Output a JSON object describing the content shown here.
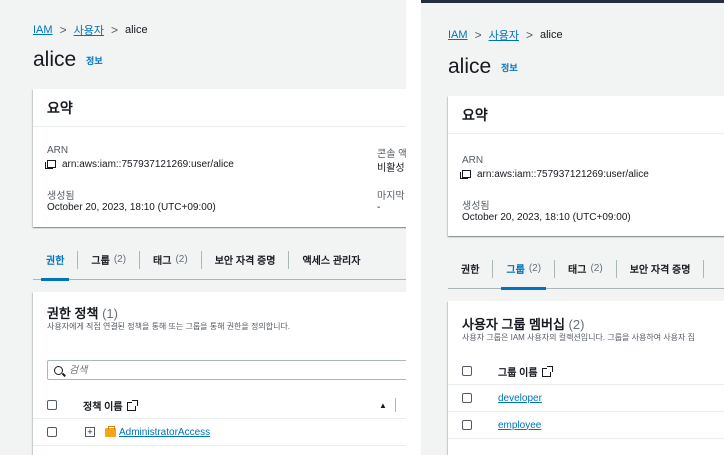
{
  "breadcrumb": {
    "root": "IAM",
    "users": "사용자",
    "current": "alice"
  },
  "page": {
    "title": "alice",
    "info": "정보"
  },
  "summary": {
    "heading": "요약",
    "arn_label": "ARN",
    "arn_value": "arn:aws:iam::757937121269:user/alice",
    "created_label": "생성됨",
    "created_value": "October 20, 2023, 18:10 (UTC+09:00)",
    "console_label_cut": "콘솔 액",
    "console_value_cut": "비활성",
    "last_label_cut": "마지막",
    "last_value_cut": "-"
  },
  "tabs": {
    "permissions": "권한",
    "groups": "그룹",
    "groups_count": "(2)",
    "tags": "태그",
    "tags_count": "(2)",
    "security": "보안 자격 증명",
    "access": "액세스 관리자"
  },
  "left": {
    "section_title": "권한 정책",
    "section_count": "(1)",
    "section_desc": "사용자에게 직접 연결된 정책을 통해 또는 그룹을 통해 권한을 정의합니다.",
    "search_placeholder": "검색",
    "col_policy_name": "정책 이름",
    "sort_glyph": "▲",
    "rows": [
      {
        "name": "AdministratorAccess"
      }
    ]
  },
  "right": {
    "section_title": "사용자 그룹 멤버십",
    "section_count": "(2)",
    "section_desc": "사용자 그룹은 IAM 사용자의 컬렉션입니다. 그룹을 사용하여 사용자 집",
    "col_group_name": "그룹 이름",
    "rows": [
      {
        "name": "developer"
      },
      {
        "name": "employee"
      }
    ]
  },
  "colors": {
    "link": "#0073bb",
    "background": "#f2f3f3",
    "header_bar": "#232f3e",
    "policy_icon": "#f7a51c"
  }
}
